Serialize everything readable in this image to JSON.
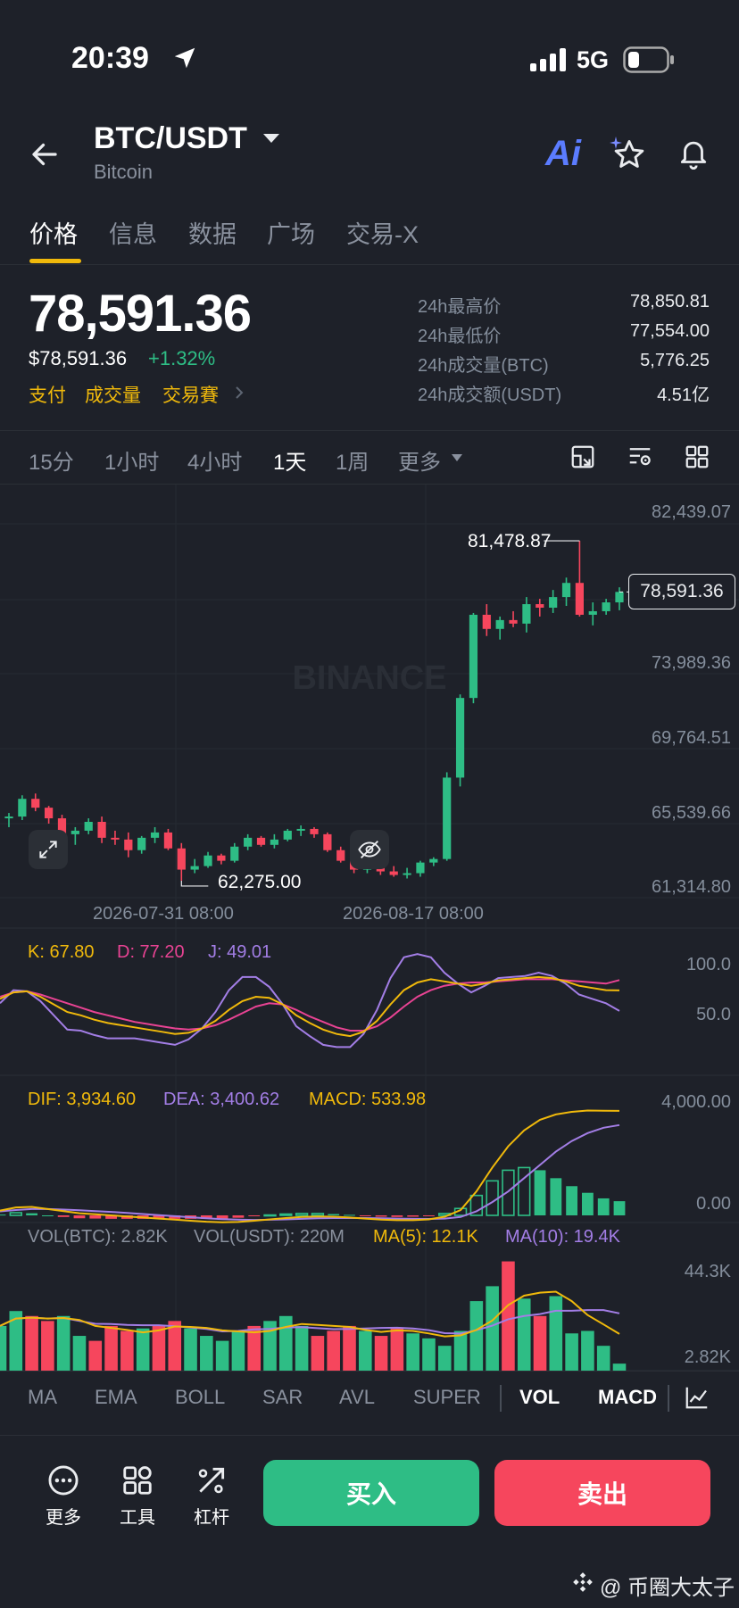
{
  "status_bar": {
    "time": "20:39",
    "network": "5G"
  },
  "header": {
    "pair": "BTC/USDT",
    "name": "Bitcoin",
    "ai_label": "Ai"
  },
  "tabs": [
    {
      "label": "价格",
      "active": true
    },
    {
      "label": "信息",
      "active": false
    },
    {
      "label": "数据",
      "active": false
    },
    {
      "label": "广场",
      "active": false
    },
    {
      "label": "交易-X",
      "active": false
    }
  ],
  "price": {
    "last": "78,591.36",
    "usd": "$78,591.36",
    "change": "+1.32%"
  },
  "tags": [
    "支付",
    "成交量",
    "交易賽"
  ],
  "stats": [
    {
      "label": "24h最高价",
      "value": "78,850.81"
    },
    {
      "label": "24h最低价",
      "value": "77,554.00"
    },
    {
      "label": "24h成交量(BTC)",
      "value": "5,776.25"
    },
    {
      "label": "24h成交额(USDT)",
      "value": "4.51亿"
    }
  ],
  "timeframes": [
    {
      "label": "15分",
      "active": false
    },
    {
      "label": "1小时",
      "active": false
    },
    {
      "label": "4小时",
      "active": false
    },
    {
      "label": "1天",
      "active": true
    },
    {
      "label": "1周",
      "active": false
    },
    {
      "label": "更多",
      "active": false
    }
  ],
  "watermark": "BINANCE",
  "main_chart": {
    "price_axis": [
      "82,439.07",
      "78,591.36",
      "73,989.36",
      "69,764.51",
      "65,539.66",
      "61,314.80"
    ],
    "high_label": "81,478.87",
    "low_label": "62,275.00",
    "last_label": "78,591.36",
    "dates": [
      "2026-07-31 08:00",
      "2026-08-17 08:00"
    ]
  },
  "kdj": {
    "k": "K: 67.80",
    "d": "D: 77.20",
    "j": "J: 49.01",
    "axis": [
      "100.0",
      "50.0"
    ]
  },
  "macd": {
    "dif": "DIF: 3,934.60",
    "dea": "DEA: 3,400.62",
    "macd": "MACD: 533.98",
    "axis": [
      "4,000.00",
      "0.00"
    ]
  },
  "vol": {
    "btc": "VOL(BTC): 2.82K",
    "usdt": "VOL(USDT): 220M",
    "ma5": "MA(5): 12.1K",
    "ma10": "MA(10): 19.4K",
    "axis": [
      "44.3K",
      "2.82K"
    ]
  },
  "indicator_tabs": [
    {
      "label": "MA",
      "active": false
    },
    {
      "label": "EMA",
      "active": false
    },
    {
      "label": "BOLL",
      "active": false
    },
    {
      "label": "SAR",
      "active": false
    },
    {
      "label": "AVL",
      "active": false
    },
    {
      "label": "SUPER",
      "active": false
    },
    {
      "label": "VOL",
      "active": true
    },
    {
      "label": "MACD",
      "active": true
    }
  ],
  "bottom_tools": [
    "更多",
    "工具",
    "杠杆"
  ],
  "actions": {
    "buy": "买入",
    "sell": "卖出"
  },
  "footer_watermark": "@ 币圈大太子",
  "colors": {
    "up": "#2ebd85",
    "down": "#f6465d",
    "accent": "#f0b90b",
    "bg": "#1e2129"
  },
  "chart_data": {
    "type": "candlestick",
    "interval": "1天",
    "ylim": [
      61314.8,
      82439.07
    ],
    "candles": [
      [
        65800,
        66100,
        65300,
        65900
      ],
      [
        65900,
        67100,
        65700,
        66900
      ],
      [
        66900,
        67200,
        66200,
        66400
      ],
      [
        66400,
        66500,
        65500,
        65800
      ],
      [
        65800,
        66000,
        64700,
        64900
      ],
      [
        64900,
        65300,
        64300,
        65100
      ],
      [
        65100,
        65800,
        64900,
        65600
      ],
      [
        65600,
        65900,
        64400,
        64700
      ],
      [
        64700,
        65100,
        64300,
        64600
      ],
      [
        64600,
        65000,
        63600,
        64000
      ],
      [
        64000,
        64800,
        63800,
        64700
      ],
      [
        64700,
        65300,
        64400,
        65000
      ],
      [
        65000,
        65200,
        64000,
        64100
      ],
      [
        64100,
        64400,
        62275,
        62900
      ],
      [
        62900,
        63500,
        62700,
        63100
      ],
      [
        63100,
        63900,
        63000,
        63700
      ],
      [
        63700,
        63800,
        63200,
        63400
      ],
      [
        63400,
        64400,
        63300,
        64200
      ],
      [
        64200,
        64900,
        64000,
        64700
      ],
      [
        64700,
        64800,
        64200,
        64300
      ],
      [
        64300,
        64900,
        64100,
        64600
      ],
      [
        64600,
        65200,
        64500,
        65100
      ],
      [
        65100,
        65400,
        64800,
        65200
      ],
      [
        65200,
        65300,
        64700,
        64900
      ],
      [
        64900,
        65000,
        63900,
        64000
      ],
      [
        64000,
        64200,
        63300,
        63400
      ],
      [
        63400,
        63600,
        62700,
        62900
      ],
      [
        62900,
        63200,
        62700,
        63000
      ],
      [
        63000,
        63200,
        62600,
        62800
      ],
      [
        62800,
        63100,
        62500,
        62600
      ],
      [
        62600,
        63000,
        62400,
        62700
      ],
      [
        62700,
        63400,
        62500,
        63300
      ],
      [
        63300,
        63600,
        63100,
        63500
      ],
      [
        63500,
        68400,
        63400,
        68100
      ],
      [
        68100,
        72800,
        67600,
        72600
      ],
      [
        72600,
        77400,
        72300,
        77300
      ],
      [
        77300,
        77900,
        76100,
        76500
      ],
      [
        76500,
        77200,
        75900,
        77000
      ],
      [
        77000,
        77500,
        76600,
        76800
      ],
      [
        76800,
        78300,
        76300,
        77900
      ],
      [
        77900,
        78200,
        77200,
        77700
      ],
      [
        77700,
        78700,
        77400,
        78300
      ],
      [
        78300,
        79400,
        77800,
        79100
      ],
      [
        79100,
        81478.87,
        77200,
        77300
      ],
      [
        77300,
        78000,
        76700,
        77500
      ],
      [
        77500,
        78200,
        77300,
        78000
      ],
      [
        78000,
        78850.81,
        77554,
        78591.36
      ]
    ],
    "kdj": {
      "k": [
        60,
        66,
        67,
        62,
        55,
        48,
        45,
        41,
        38,
        36,
        34,
        32,
        30,
        28,
        29,
        33,
        40,
        50,
        58,
        62,
        61,
        55,
        45,
        38,
        32,
        28,
        26,
        30,
        40,
        55,
        68,
        75,
        78,
        76,
        74,
        72,
        74,
        77,
        78,
        79,
        80,
        79,
        76,
        72,
        70,
        68,
        67.8
      ],
      "d": [
        62,
        66,
        67,
        64,
        60,
        56,
        52,
        48,
        45,
        42,
        39,
        37,
        35,
        33,
        32,
        33,
        36,
        41,
        47,
        53,
        56,
        55,
        50,
        44,
        39,
        34,
        31,
        31,
        35,
        43,
        53,
        62,
        68,
        72,
        74,
        75,
        75,
        76,
        77,
        78,
        78,
        78,
        77,
        76,
        75,
        74,
        77.2
      ],
      "j": [
        56,
        68,
        67,
        58,
        45,
        32,
        31,
        27,
        24,
        24,
        24,
        22,
        20,
        18,
        23,
        33,
        48,
        68,
        80,
        80,
        71,
        55,
        35,
        26,
        18,
        16,
        16,
        28,
        50,
        79,
        98,
        101,
        98,
        84,
        74,
        66,
        72,
        79,
        80,
        81,
        84,
        81,
        74,
        64,
        60,
        56,
        49.01
      ]
    },
    "macd": {
      "dif": [
        180,
        300,
        320,
        240,
        160,
        80,
        40,
        0,
        -40,
        -80,
        -120,
        -160,
        -200,
        -240,
        -260,
        -250,
        -200,
        -150,
        -100,
        -60,
        -40,
        -50,
        -80,
        -120,
        -160,
        -180,
        -180,
        -150,
        -50,
        200,
        900,
        1800,
        2600,
        3200,
        3600,
        3800,
        3900,
        3950,
        3940,
        3934.6
      ],
      "dea": [
        150,
        200,
        240,
        240,
        220,
        190,
        160,
        130,
        90,
        50,
        10,
        -30,
        -70,
        -110,
        -140,
        -160,
        -170,
        -165,
        -150,
        -130,
        -110,
        -100,
        -100,
        -100,
        -110,
        -120,
        -130,
        -135,
        -120,
        -60,
        150,
        500,
        900,
        1400,
        1900,
        2400,
        2800,
        3100,
        3300,
        3400.62
      ],
      "hist": [
        30,
        100,
        80,
        0,
        -60,
        -110,
        -120,
        -130,
        -130,
        -130,
        -130,
        -130,
        -130,
        -130,
        -120,
        -90,
        -30,
        15,
        50,
        70,
        70,
        50,
        20,
        -20,
        -50,
        -60,
        -50,
        -15,
        70,
        260,
        750,
        1300,
        1700,
        1800,
        1700,
        1400,
        1100,
        850,
        640,
        533.98
      ]
    },
    "volume": [
      18,
      24,
      22,
      20,
      22,
      14,
      12,
      18,
      16,
      17,
      18,
      20,
      17,
      14,
      12,
      16,
      18,
      20,
      22,
      18,
      14,
      16,
      18,
      16,
      14,
      17,
      15,
      13,
      10,
      16,
      28,
      34,
      44,
      29,
      22,
      30,
      15,
      16,
      10,
      2.82
    ]
  }
}
